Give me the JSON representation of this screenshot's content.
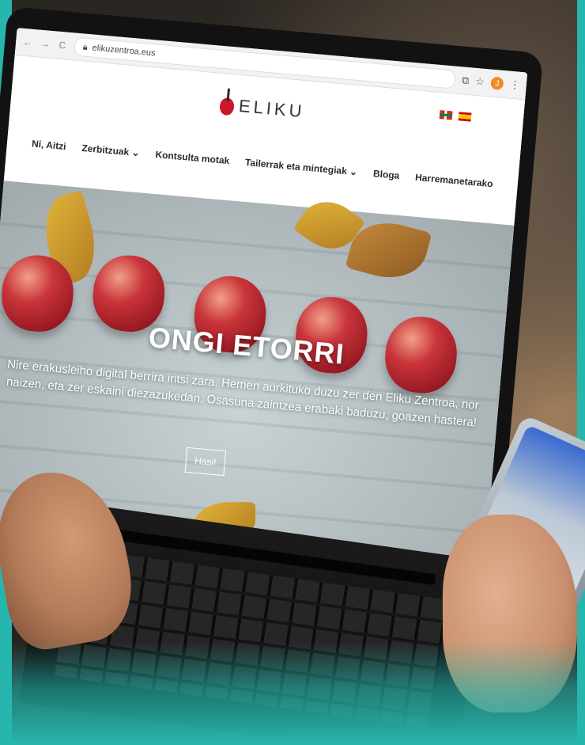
{
  "browser": {
    "url": "elikuzentroa.eus",
    "nav_back": "←",
    "nav_forward": "→",
    "nav_reload": "C",
    "profile_initial": "J"
  },
  "site": {
    "logo_text": "ELIKU",
    "languages": [
      "eu",
      "es"
    ],
    "menu": [
      {
        "label": "Ni, Aitzi"
      },
      {
        "label": "Zerbitzuak ⌄"
      },
      {
        "label": "Kontsulta motak"
      },
      {
        "label": "Tailerrak eta mintegiak ⌄"
      },
      {
        "label": "Bloga"
      },
      {
        "label": "Harremanetarako"
      }
    ]
  },
  "hero": {
    "title": "ONGI ETORRI",
    "subtitle": "Nire erakusleiho digital berrira iritsi zara. Hemen aurkituko duzu zer den Eliku Zentroa, nor naizen, eta zer eskaini diezazukedan. Osasuna zaintzea erabaki baduzu, goazen hastera!",
    "button": "Hasi!"
  },
  "colors": {
    "frame_accent": "#27b6ad",
    "apple_red": "#c8182b",
    "profile_orange": "#f08a24"
  }
}
